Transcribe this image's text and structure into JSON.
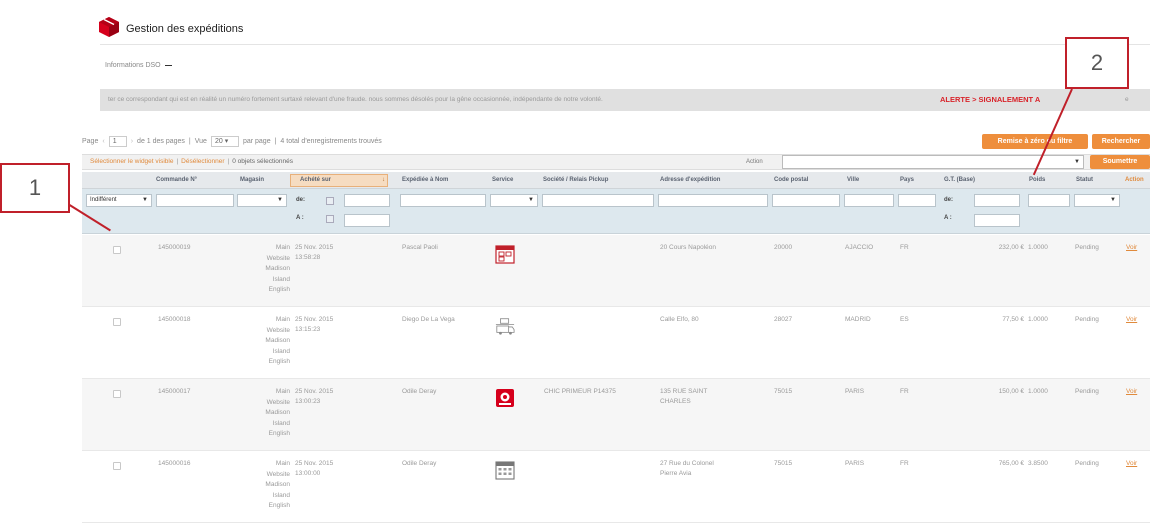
{
  "app": {
    "title": "Gestion des expéditions"
  },
  "info": {
    "label": "Informations DSO"
  },
  "alert": {
    "text": "ter ce correspondant qui est en réalité un numéro fortement surtaxé relevant d'une fraude. nous sommes désolés pour la gêne occasionnée, indépendante de notre volonté.",
    "label": "ALERTE > SIGNALEMENT A",
    "suffix": "e"
  },
  "pager": {
    "page_label": "Page",
    "page_value": "1",
    "pages_text": "de 1 des pages",
    "sep1": "|",
    "view_label": "Vue",
    "per_page": "20",
    "per_page_suffix": "par page",
    "sep2": "|",
    "records": "4 total d'enregistrements trouvés"
  },
  "buttons": {
    "reset": "Remise à zéro du filtre",
    "search": "Rechercher",
    "submit": "Soumettre"
  },
  "mass": {
    "select_visible": "Sélectionner le widget visible",
    "sep": "|",
    "unselect": "Désélectionner",
    "selected": "0 objets sélectionnés",
    "actions_label": "Action"
  },
  "table": {
    "headers": {
      "order": "Commande N°",
      "store": "Magasin",
      "created": "Achété sur",
      "ship_to": "Expédiée à Nom",
      "service": "Service",
      "company": "Société / Relais Pickup",
      "address": "Adresse d'expédition",
      "zip": "Code postal",
      "city": "Ville",
      "country": "Pays",
      "total": "G.T. (Base)",
      "weight": "Poids",
      "status": "Statut",
      "action": "Action"
    },
    "filters": {
      "any": "Indifférent",
      "from": "de:",
      "to": "A :"
    },
    "rows": [
      {
        "order": "145000019",
        "store": [
          "Main",
          "Website",
          "Madison",
          "Island",
          "English"
        ],
        "date": "25 Nov. 2015",
        "time": "13:58:28",
        "name": "Pascal Paoli",
        "service_icon": "calendar-relay-icon",
        "company": "",
        "address": [
          "20 Cours Napoléon",
          ""
        ],
        "zip": "20000",
        "city": "AJACCIO",
        "country": "FR",
        "total": "232,00 €",
        "weight": "1.0000",
        "status": "Pending",
        "action": "Voir"
      },
      {
        "order": "145000018",
        "store": [
          "Main",
          "Website",
          "Madison",
          "Island",
          "English"
        ],
        "date": "25 Nov. 2015",
        "time": "13:15:23",
        "name": "Diego De La Vega",
        "service_icon": "delivery-truck-icon",
        "company": "",
        "address": [
          "Calle Elfo, 80",
          ""
        ],
        "zip": "28027",
        "city": "MADRID",
        "country": "ES",
        "total": "77,50 €",
        "weight": "1.0000",
        "status": "Pending",
        "action": "Voir"
      },
      {
        "order": "145000017",
        "store": [
          "Main",
          "Website",
          "Madison",
          "Island",
          "English"
        ],
        "date": "25 Nov. 2015",
        "time": "13:00:23",
        "name": "Odile Deray",
        "service_icon": "pickup-relay-icon",
        "company": "CHIC PRIMEUR P14375",
        "address": [
          "135 RUE SAINT",
          "CHARLES"
        ],
        "zip": "75015",
        "city": "PARIS",
        "country": "FR",
        "total": "150,00 €",
        "weight": "1.0000",
        "status": "Pending",
        "action": "Voir"
      },
      {
        "order": "145000016",
        "store": [
          "Main",
          "Website",
          "Madison",
          "Island",
          "English"
        ],
        "date": "25 Nov. 2015",
        "time": "13:00:00",
        "name": "Odile Deray",
        "service_icon": "calendar-predict-icon",
        "company": "",
        "address": [
          "27 Rue du Colonel",
          "Pierre Avia"
        ],
        "zip": "75015",
        "city": "PARIS",
        "country": "FR",
        "total": "765,00 €",
        "weight": "3.8500",
        "status": "Pending",
        "action": "Voir"
      }
    ]
  },
  "callouts": {
    "c1": "1",
    "c2": "2"
  },
  "colors": {
    "accent": "#ee8e3c",
    "alert": "#d8232a",
    "callout": "#c0202a",
    "header_bg": "#e6e9ec",
    "filter_bg": "#dde8ee"
  }
}
